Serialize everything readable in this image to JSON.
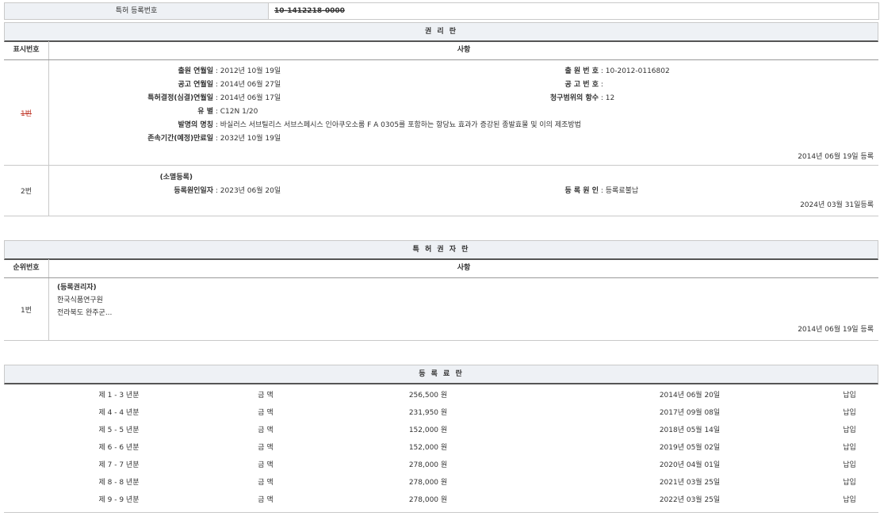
{
  "top": {
    "label": "특허 등록번호",
    "value": "10-1412218-0000"
  },
  "rights": {
    "title": "권 리 란",
    "col_num": "표시번호",
    "col_item": "사항",
    "row1": {
      "num": "1번",
      "left": [
        {
          "k": "출원 연월일",
          "v": "2012년 10월 19일"
        },
        {
          "k": "공고 연월일",
          "v": "2014년 06월 27일"
        },
        {
          "k": "특허결정(심결)연월일",
          "v": "2014년 06월 17일"
        },
        {
          "k": "유 별",
          "v": "C12N 1/20"
        },
        {
          "k": "발명의 명칭",
          "v": "바실러스 서브틸리스 서브스페시스 인아쿠오소룸 F A 0305를 포함하는 항당뇨 효과가 증강된 종발효물 및 이의 제조방법"
        },
        {
          "k": "존속기간(예정)만료일",
          "v": "2032년 10월 19일"
        }
      ],
      "right": [
        {
          "k": "출 원 번 호",
          "v": "10-2012-0116802"
        },
        {
          "k": "공 고 번 호",
          "v": ""
        },
        {
          "k": "청구범위의 항수",
          "v": "12"
        }
      ],
      "reg": "2014년 06월 19일 등록"
    },
    "row2": {
      "num": "2번",
      "heading": "(소멸등록)",
      "left": {
        "k": "등록원인일자",
        "v": "2023년 06월 20일"
      },
      "right": {
        "k": "등 록 원 인",
        "v": "등록료불납"
      },
      "reg": "2024년 03월 31일등록"
    }
  },
  "holders": {
    "title": "특 허 권 자 란",
    "col_num": "순위번호",
    "col_item": "사항",
    "row1": {
      "num": "1번",
      "lines": [
        "(등록권리자)",
        "한국식품연구원",
        "전라북도 완주군..."
      ],
      "reg": "2014년 06월 19일 등록"
    }
  },
  "fees": {
    "title": "등 록 료 란",
    "rows": [
      {
        "term": "제 1 - 3 년분",
        "label": "금 액",
        "amount": "256,500 원",
        "date": "2014년 06월 20일",
        "status": "납입"
      },
      {
        "term": "제 4 - 4 년분",
        "label": "금 액",
        "amount": "231,950 원",
        "date": "2017년 09월 08일",
        "status": "납입"
      },
      {
        "term": "제 5 - 5 년분",
        "label": "금 액",
        "amount": "152,000 원",
        "date": "2018년 05월 14일",
        "status": "납입"
      },
      {
        "term": "제 6 - 6 년분",
        "label": "금 액",
        "amount": "152,000 원",
        "date": "2019년 05월 02일",
        "status": "납입"
      },
      {
        "term": "제 7 - 7 년분",
        "label": "금 액",
        "amount": "278,000 원",
        "date": "2020년 04월 01일",
        "status": "납입"
      },
      {
        "term": "제 8 - 8 년분",
        "label": "금 액",
        "amount": "278,000 원",
        "date": "2021년 03월 25일",
        "status": "납입"
      },
      {
        "term": "제 9 - 9 년분",
        "label": "금 액",
        "amount": "278,000 원",
        "date": "2022년 03월 25일",
        "status": "납입"
      }
    ]
  }
}
